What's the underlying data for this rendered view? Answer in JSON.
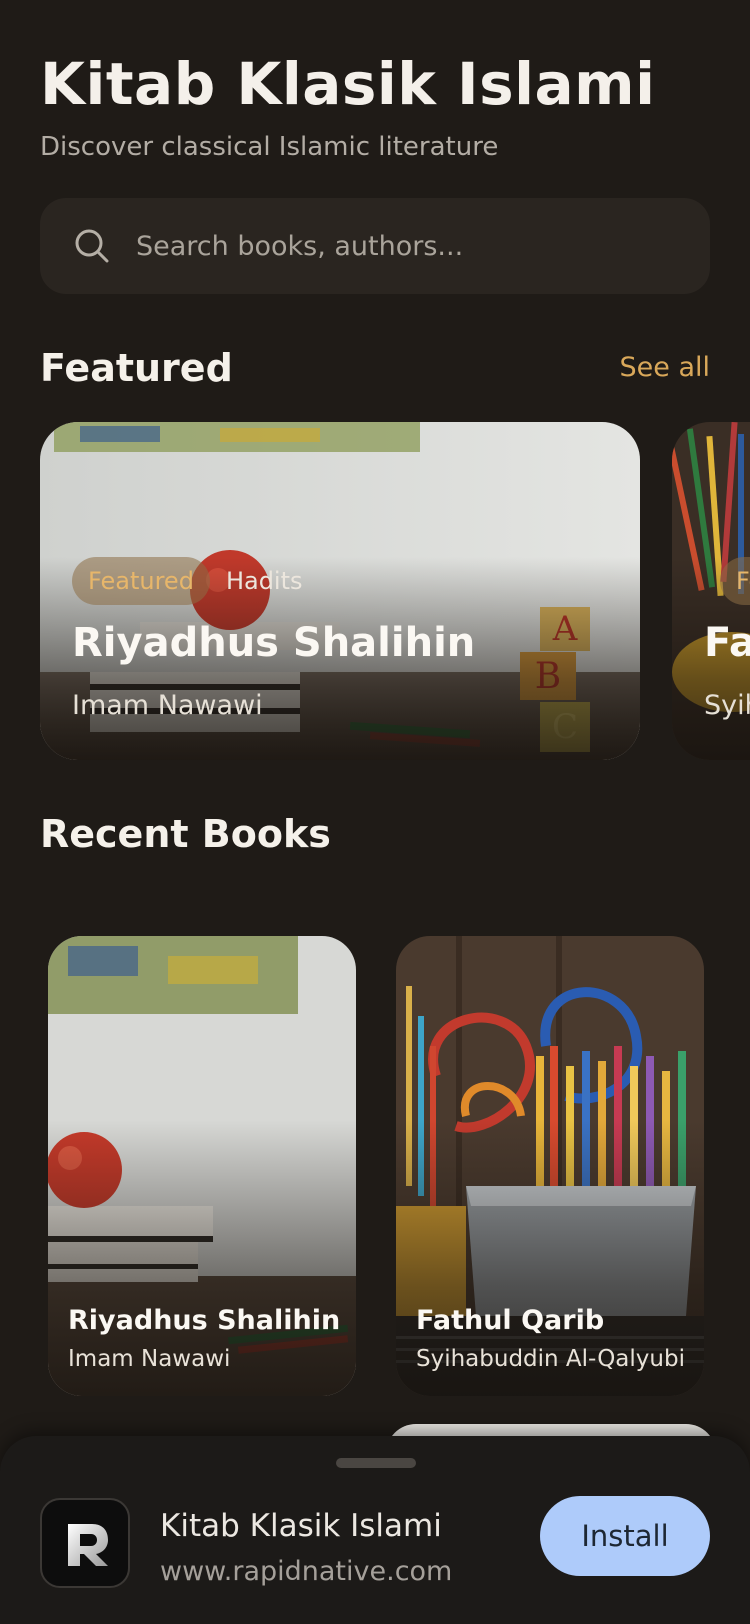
{
  "header": {
    "title": "Kitab Klasik Islami",
    "subtitle": "Discover classical Islamic literature"
  },
  "search": {
    "placeholder": "Search books, authors...",
    "icon": "search-icon"
  },
  "featured": {
    "section_title": "Featured",
    "see_all": "See all",
    "cards": [
      {
        "badge": "Featured",
        "category": "Hadits",
        "title": "Riyadhus Shalihin",
        "author": "Imam Nawawi",
        "image": "apple-books-photo"
      },
      {
        "badge": "Fea",
        "title": "Fa",
        "author": "Syih",
        "image": "pencils-photo"
      }
    ]
  },
  "recent": {
    "section_title": "Recent Books",
    "books": [
      {
        "title": "Riyadhus Shalihin",
        "author": "Imam Nawawi",
        "image": "apple-books-photo"
      },
      {
        "title": "Fathul Qarib",
        "author": "Syihabuddin Al-Qalyubi",
        "image": "pencils-photo"
      }
    ]
  },
  "install_banner": {
    "app_name": "Kitab Klasik Islami",
    "url": "www.rapidnative.com",
    "button": "Install",
    "button_color": "#aecbfa"
  },
  "colors": {
    "background": "#1f1b17",
    "accent": "#d9a85a"
  }
}
